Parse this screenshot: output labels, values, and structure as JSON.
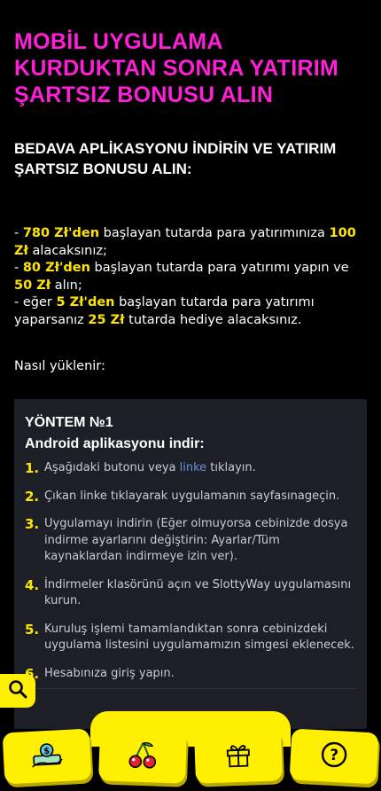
{
  "title": "MOBİL UYGULAMA KURDUKTAN SONRA YATIRIM ŞARTSIZ BONUSU ALIN",
  "subtitle": "BEDAVA APLİKASYONU İNDİRİN VE YATIRIM ŞARTSIZ BONUSU ALIN:",
  "offers": {
    "o1_pre": "- ",
    "o1_amount": "780 Zł'den",
    "o1_mid": " başlayan tutarda para yatırımınıza ",
    "o1_bonus": "100 Zł",
    "o1_post": " alacaksınız;",
    "o2_pre": "- ",
    "o2_amount": "80 Zł'den",
    "o2_mid": " başlayan tutarda para yatırımı yapın ve ",
    "o2_bonus": "50 Zł",
    "o2_post": " alın;",
    "o3_pre": "- eğer ",
    "o3_amount": "5 Zł'den",
    "o3_mid": " başlayan tutarda para yatırımı yaparsanız ",
    "o3_bonus": "25 Zł",
    "o3_post": " tutarda hediye alacaksınız."
  },
  "howto_label": "Nasıl yüklenir:",
  "method": {
    "title": "YÖNTEM №1",
    "subtitle": "Android aplikasyonu indir:",
    "steps": [
      {
        "num": "1.",
        "pre": "Aşağıdaki butonu veya ",
        "link": "linke",
        "post": " tıklayın."
      },
      {
        "num": "2.",
        "text": "Çıkan linke tıklayarak uygulamanın sayfasınageçin."
      },
      {
        "num": "3.",
        "text": "Uygulamayı indirin (Eğer olmuyorsa cebinizde dosya indirme ayarlarını değiştirin: Ayarlar/Tüm kaynaklardan indirmeye izin ver)."
      },
      {
        "num": "4.",
        "text": "İndirmeler klasörünü açın ve SlottyWay uygulamasını kurun."
      },
      {
        "num": "5.",
        "text": "Kuruluş işlemi tamamlandıktan sonra cebinizdeki uygulama listesini uygulamamızın simgesi eklenecek."
      },
      {
        "num": "6.",
        "text": "Hesabınıza giriş yapın."
      }
    ]
  },
  "icons": {
    "search": "search-icon",
    "nav": [
      "money-icon",
      "cherry-icon",
      "gift-icon",
      "help-icon"
    ]
  },
  "colors": {
    "accent_pink": "#ff1fd6",
    "accent_yellow": "#ffef00",
    "card_bg": "#1c1f26",
    "link": "#6f8fd8"
  }
}
